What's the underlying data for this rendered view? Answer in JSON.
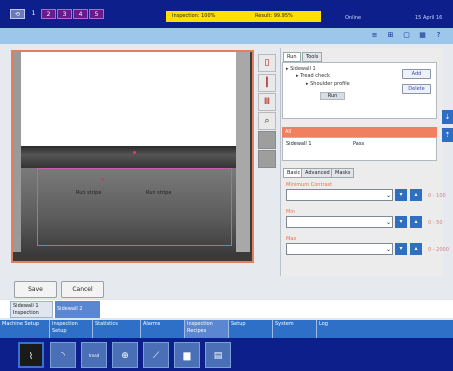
{
  "topbar": {
    "buttons": [
      "⟲",
      "1",
      "2",
      "3",
      "4",
      "5"
    ],
    "status_left": "Inspection: 100%",
    "status_right": "Result: 99.95%",
    "center_text": "Online",
    "datetime": "15 April 16"
  },
  "toolbar": {
    "icons": [
      "≡",
      "⊞",
      "▢",
      "▦",
      "?"
    ]
  },
  "image": {
    "roi_label_1": "Run stripe",
    "roi_label_2": "Run stripe"
  },
  "right_panel": {
    "tabs": [
      "Run",
      "Tools"
    ],
    "tree": [
      "Sidewall 1",
      "Tread check",
      "Shoulder profile",
      "Run"
    ],
    "add_label": "Add",
    "delete_label": "Delete",
    "section_header": "All",
    "info_left": "Sidewall 1",
    "info_right": "Pass",
    "subtabs": [
      "Basic",
      "Advanced",
      "Masks"
    ],
    "fields": [
      {
        "label": "Minimum Contrast",
        "value": "",
        "right": "0 - 100"
      },
      {
        "label": "Min",
        "value": "",
        "right": "0 - 50"
      },
      {
        "label": "Max",
        "value": "",
        "right": "0 - 2000"
      }
    ]
  },
  "actions": {
    "save": "Save",
    "cancel": "Cancel"
  },
  "row1_tabs": [
    "Sidewall 1 Inspection",
    "Sidewall 2"
  ],
  "row2_tabs": [
    "Machine Setup",
    "Inspection Setup",
    "Statistics",
    "Alarms",
    "Inspection Recipes",
    "Setup",
    "System",
    "Log"
  ],
  "thumbnails": [
    "⌇",
    "◝",
    "tread",
    "⊕",
    "⟋",
    "▆",
    "▤"
  ],
  "colors": {
    "brand_dark": "#0c1f8a",
    "status_yellow": "#ffe000",
    "accent_blue": "#2e6fc8",
    "alert_orange": "#f18060",
    "roi_magenta": "#c85cb4"
  }
}
